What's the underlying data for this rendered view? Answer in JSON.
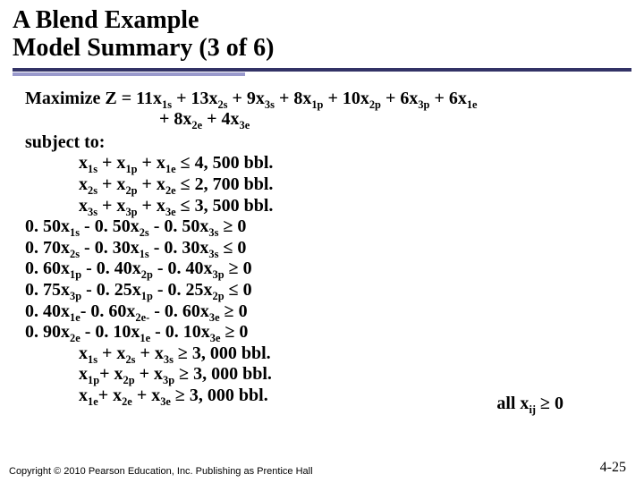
{
  "title_line1": "A Blend Example",
  "title_line2": "Model Summary (3 of 6)",
  "objective_label": "Maximize Z = ",
  "objective_part1": "11x",
  "obj_sub1": "1s",
  "objective_part2": " + 13x",
  "obj_sub2": "2s",
  "objective_part3": " + 9x",
  "obj_sub3": "3s",
  "objective_part4": " + 8x",
  "obj_sub4": "1p",
  "objective_part5": " + 10x",
  "obj_sub5": "2p",
  "objective_part6": " + 6x",
  "obj_sub6": "3p",
  "objective_part7": " + 6x",
  "obj_sub7": "1e",
  "obj_line2_a": "+ 8x",
  "obj_l2_sub1": "2e",
  "obj_line2_b": " + 4x",
  "obj_l2_sub2": "3e",
  "subject_to": "subject to:",
  "c1_a": "x",
  "c1_s1": "1s",
  "c1_b": " + x",
  "c1_s2": "1p",
  "c1_c": " + x",
  "c1_s3": "1e",
  "c1_d": " ≤ 4, 500 bbl.",
  "c2_a": "x",
  "c2_s1": "2s",
  "c2_b": " + x",
  "c2_s2": "2p",
  "c2_c": "  + x",
  "c2_s3": "2e",
  "c2_d": " ≤ 2, 700 bbl.",
  "c3_a": "x",
  "c3_s1": "3s",
  "c3_b": " + x",
  "c3_s2": "3p",
  "c3_c": " + x",
  "c3_s3": "3e",
  "c3_d": " ≤ 3, 500 bbl.",
  "c4_a": "0. 50x",
  "c4_s1": "1s",
  "c4_b": " - 0. 50x",
  "c4_s2": "2s",
  "c4_c": " - 0. 50x",
  "c4_s3": "3s",
  "c4_d": " ≥ 0",
  "c5_a": "0. 70x",
  "c5_s1": "2s",
  "c5_b": " - 0. 30x",
  "c5_s2": "1s",
  "c5_c": " - 0. 30x",
  "c5_s3": "3s",
  "c5_d": " ≤ 0",
  "c6_a": "0. 60x",
  "c6_s1": "1p",
  "c6_b": " - 0. 40x",
  "c6_s2": "2p",
  "c6_c": " - 0. 40x",
  "c6_s3": "3p",
  "c6_d": " ≥ 0",
  "c7_a": "0. 75x",
  "c7_s1": "3p",
  "c7_b": " - 0. 25x",
  "c7_s2": "1p",
  "c7_c": " - 0. 25x",
  "c7_s3": "2p",
  "c7_d": " ≤ 0",
  "c8_a": "0. 40x",
  "c8_s1": "1e",
  "c8_b": "- 0. 60x",
  "c8_s2": "2e",
  "c8_bb": "-",
  "c8_c": " - 0. 60x",
  "c8_s3": "3e",
  "c8_d": " ≥ 0",
  "c9_a": "0. 90x",
  "c9_s1": "2e",
  "c9_b": " - 0. 10x",
  "c9_s2": "1e",
  "c9_c": " - 0. 10x",
  "c9_s3": "3e",
  "c9_d": " ≥ 0",
  "c10_a": "x",
  "c10_s1": "1s",
  "c10_b": " + x",
  "c10_s2": "2s",
  "c10_c": " + x",
  "c10_s3": "3s",
  "c10_d": " ≥ 3, 000 bbl.",
  "c11_a": "x",
  "c11_s1": "1p",
  "c11_b": "+ x",
  "c11_s2": "2p",
  "c11_c": " + x",
  "c11_s3": "3p",
  "c11_d": " ≥ 3, 000 bbl.",
  "c12_a": "x",
  "c12_s1": "1e",
  "c12_b": "+ x",
  "c12_s2": "2e",
  "c12_c": " + x",
  "c12_s3": "3e",
  "c12_d": " ≥ 3, 000 bbl.",
  "nonneg_a": "all x",
  "nonneg_sub": "ij",
  "nonneg_b": " ≥ 0",
  "copyright": "Copyright © 2010 Pearson Education, Inc. Publishing as Prentice Hall",
  "pagenum": "4-25"
}
